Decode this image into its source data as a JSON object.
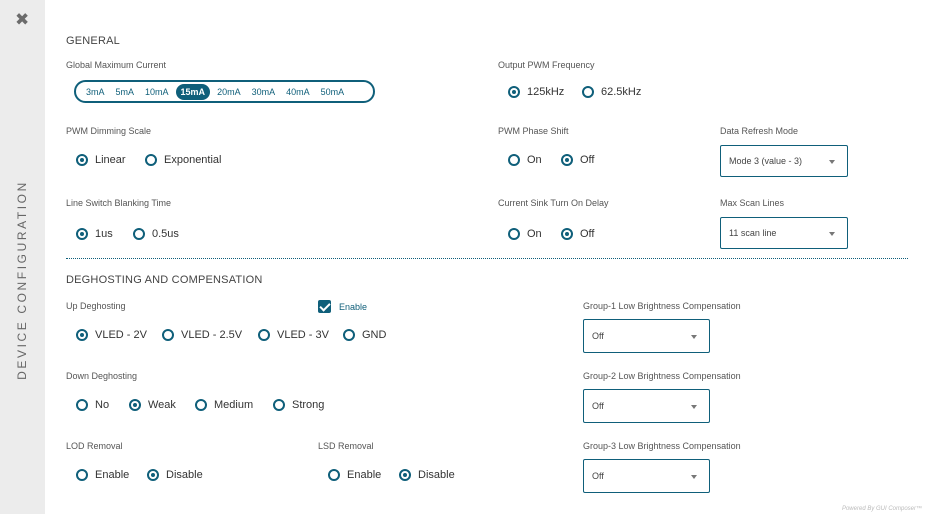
{
  "sidebar": {
    "close_glyph": "✖",
    "title": "DEVICE CONFIGURATION"
  },
  "general": {
    "heading": "GENERAL",
    "global_max_current": {
      "label": "Global Maximum Current",
      "options": [
        "3mA",
        "5mA",
        "10mA",
        "15mA",
        "20mA",
        "30mA",
        "40mA",
        "50mA"
      ],
      "selected": "15mA"
    },
    "output_pwm_frequency": {
      "label": "Output PWM Frequency",
      "options": [
        "125kHz",
        "62.5kHz"
      ],
      "selected": "125kHz"
    },
    "pwm_dimming_scale": {
      "label": "PWM Dimming Scale",
      "options": [
        "Linear",
        "Exponential"
      ],
      "selected": "Linear"
    },
    "pwm_phase_shift": {
      "label": "PWM Phase Shift",
      "options": [
        "On",
        "Off"
      ],
      "selected": "Off"
    },
    "data_refresh_mode": {
      "label": "Data Refresh Mode",
      "value": "Mode 3 (value - 3)"
    },
    "line_switch_blanking_time": {
      "label": "Line Switch Blanking Time",
      "options": [
        "1us",
        "0.5us"
      ],
      "selected": "1us"
    },
    "current_sink_turn_on_delay": {
      "label": "Current Sink Turn On Delay",
      "options": [
        "On",
        "Off"
      ],
      "selected": "Off"
    },
    "max_scan_lines": {
      "label": "Max Scan Lines",
      "value": "11 scan line"
    }
  },
  "deghosting": {
    "heading": "DEGHOSTING AND COMPENSATION",
    "up_deghosting": {
      "label": "Up Deghosting",
      "enable_label": "Enable",
      "enabled": true,
      "options": [
        "VLED - 2V",
        "VLED - 2.5V",
        "VLED - 3V",
        "GND"
      ],
      "selected": "VLED - 2V"
    },
    "down_deghosting": {
      "label": "Down Deghosting",
      "options": [
        "No",
        "Weak",
        "Medium",
        "Strong"
      ],
      "selected": "Weak"
    },
    "lod_removal": {
      "label": "LOD Removal",
      "options": [
        "Enable",
        "Disable"
      ],
      "selected": "Disable"
    },
    "lsd_removal": {
      "label": "LSD Removal",
      "options": [
        "Enable",
        "Disable"
      ],
      "selected": "Disable"
    },
    "group1": {
      "label": "Group-1 Low Brightness Compensation",
      "value": "Off"
    },
    "group2": {
      "label": "Group-2 Low Brightness Compensation",
      "value": "Off"
    },
    "group3": {
      "label": "Group-3 Low Brightness Compensation",
      "value": "Off"
    }
  },
  "footer": "Powered By GUI Composer™",
  "colors": {
    "accent": "#0f5f7a",
    "sidebar_bg": "#ececec"
  }
}
